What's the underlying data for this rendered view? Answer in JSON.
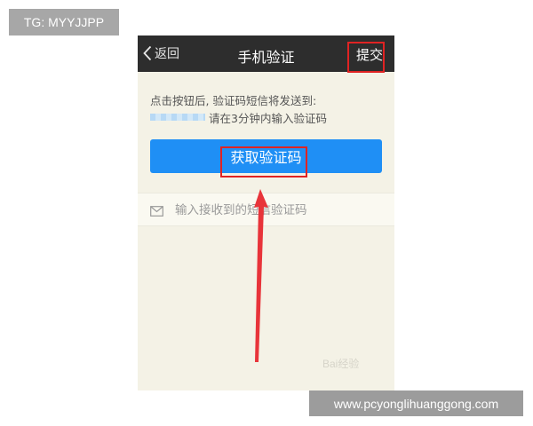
{
  "badge": {
    "text": "TG: MYYJJPP"
  },
  "nav": {
    "back_label": "返回",
    "title": "手机验证",
    "submit_label": "提交"
  },
  "hint": {
    "line1": "点击按钮后, 验证码短信将发送到:",
    "line2": "请在3分钟内输入验证码"
  },
  "get_code_button": {
    "label": "获取验证码"
  },
  "code_input": {
    "value": "",
    "placeholder": "输入接收到的短信验证码",
    "icon": "mail-icon"
  },
  "watermark": {
    "text": "Bai经验"
  },
  "url": {
    "text": "www.pcyonglihuanggong.com"
  },
  "colors": {
    "nav_bg": "#2d2d2d",
    "page_bg": "#f4f2e6",
    "button_blue": "#1f8ff5",
    "annotation_red": "#e02323"
  }
}
